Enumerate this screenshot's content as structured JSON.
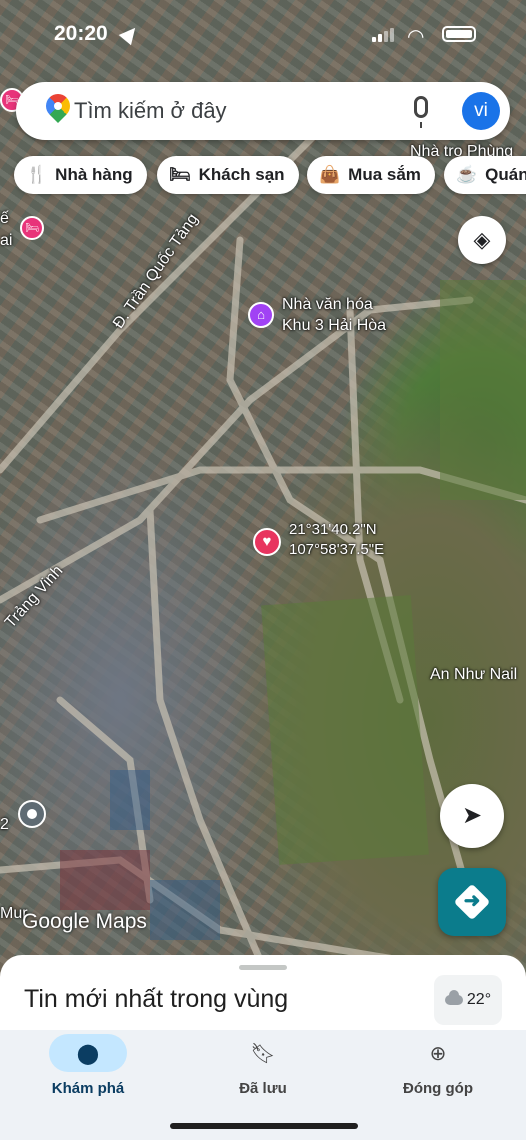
{
  "status_bar": {
    "time": "20:20"
  },
  "search": {
    "placeholder": "Tìm kiếm ở đây",
    "avatar": "vi"
  },
  "chips": [
    {
      "icon": "🍴",
      "label": "Nhà hàng"
    },
    {
      "icon": "🛏",
      "label": "Khách sạn"
    },
    {
      "icon": "👜",
      "label": "Mua sắm"
    },
    {
      "icon": "☕",
      "label": "Quán"
    }
  ],
  "map": {
    "labels": {
      "top_right": "Nhà trọ Phùng",
      "left_edge_1": "ế",
      "left_edge_2": "ai",
      "road_tran_quoc_tang": "Đ. Trần Quốc Tảng",
      "poi_culture_1": "Nhà văn hóa",
      "poi_culture_2": "Khu 3 Hải Hòa",
      "road_trang_vinh": "Trảng Vinh",
      "an_nhu_nail": "An Như Nail",
      "left_edge_3": "2",
      "bottom_left": "Mur"
    },
    "pin_coords_lat": "21°31'40.2\"N",
    "pin_coords_lng": "107°58'37.5\"E",
    "attribution": "Google Maps"
  },
  "sheet": {
    "title": "Tin mới nhất trong vùng",
    "weather_temp": "22°"
  },
  "bottom_nav": [
    {
      "label": "Khám phá",
      "active": true
    },
    {
      "label": "Đã lưu",
      "active": false
    },
    {
      "label": "Đóng góp",
      "active": false
    }
  ]
}
